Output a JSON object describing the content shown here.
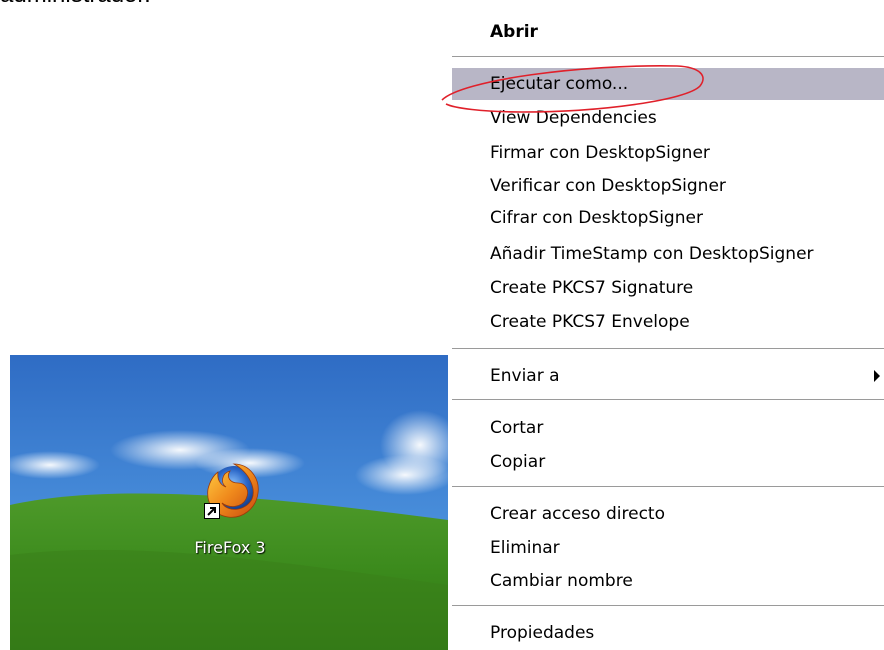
{
  "page_text": {
    "partial_line": "administrador."
  },
  "desktop": {
    "icon": {
      "name": "firefox-icon",
      "label": "FireFox 3",
      "shortcut_overlay": "shortcut-arrow-icon"
    }
  },
  "context_menu": {
    "items": [
      {
        "label": "Abrir",
        "default": true
      },
      {
        "label": "Ejecutar como...",
        "highlighted": true
      },
      {
        "label": "View Dependencies"
      },
      {
        "label": "Firmar con DesktopSigner"
      },
      {
        "label": "Verificar con DesktopSigner"
      },
      {
        "label": "Cifrar con DesktopSigner"
      },
      {
        "label": "Añadir TimeStamp con DesktopSigner"
      },
      {
        "label": "Create PKCS7 Signature"
      },
      {
        "label": "Create PKCS7 Envelope"
      },
      {
        "label": "Enviar a",
        "submenu": true
      },
      {
        "label": "Cortar"
      },
      {
        "label": "Copiar"
      },
      {
        "label": "Crear acceso directo"
      },
      {
        "label": "Eliminar"
      },
      {
        "label": "Cambiar nombre"
      },
      {
        "label": "Propiedades"
      }
    ]
  },
  "colors": {
    "highlight": "#b8b6c6",
    "annotation": "#e0202a",
    "separator": "#9a9a9a",
    "sky": "#3f82d6",
    "grass": "#3f8a20"
  }
}
